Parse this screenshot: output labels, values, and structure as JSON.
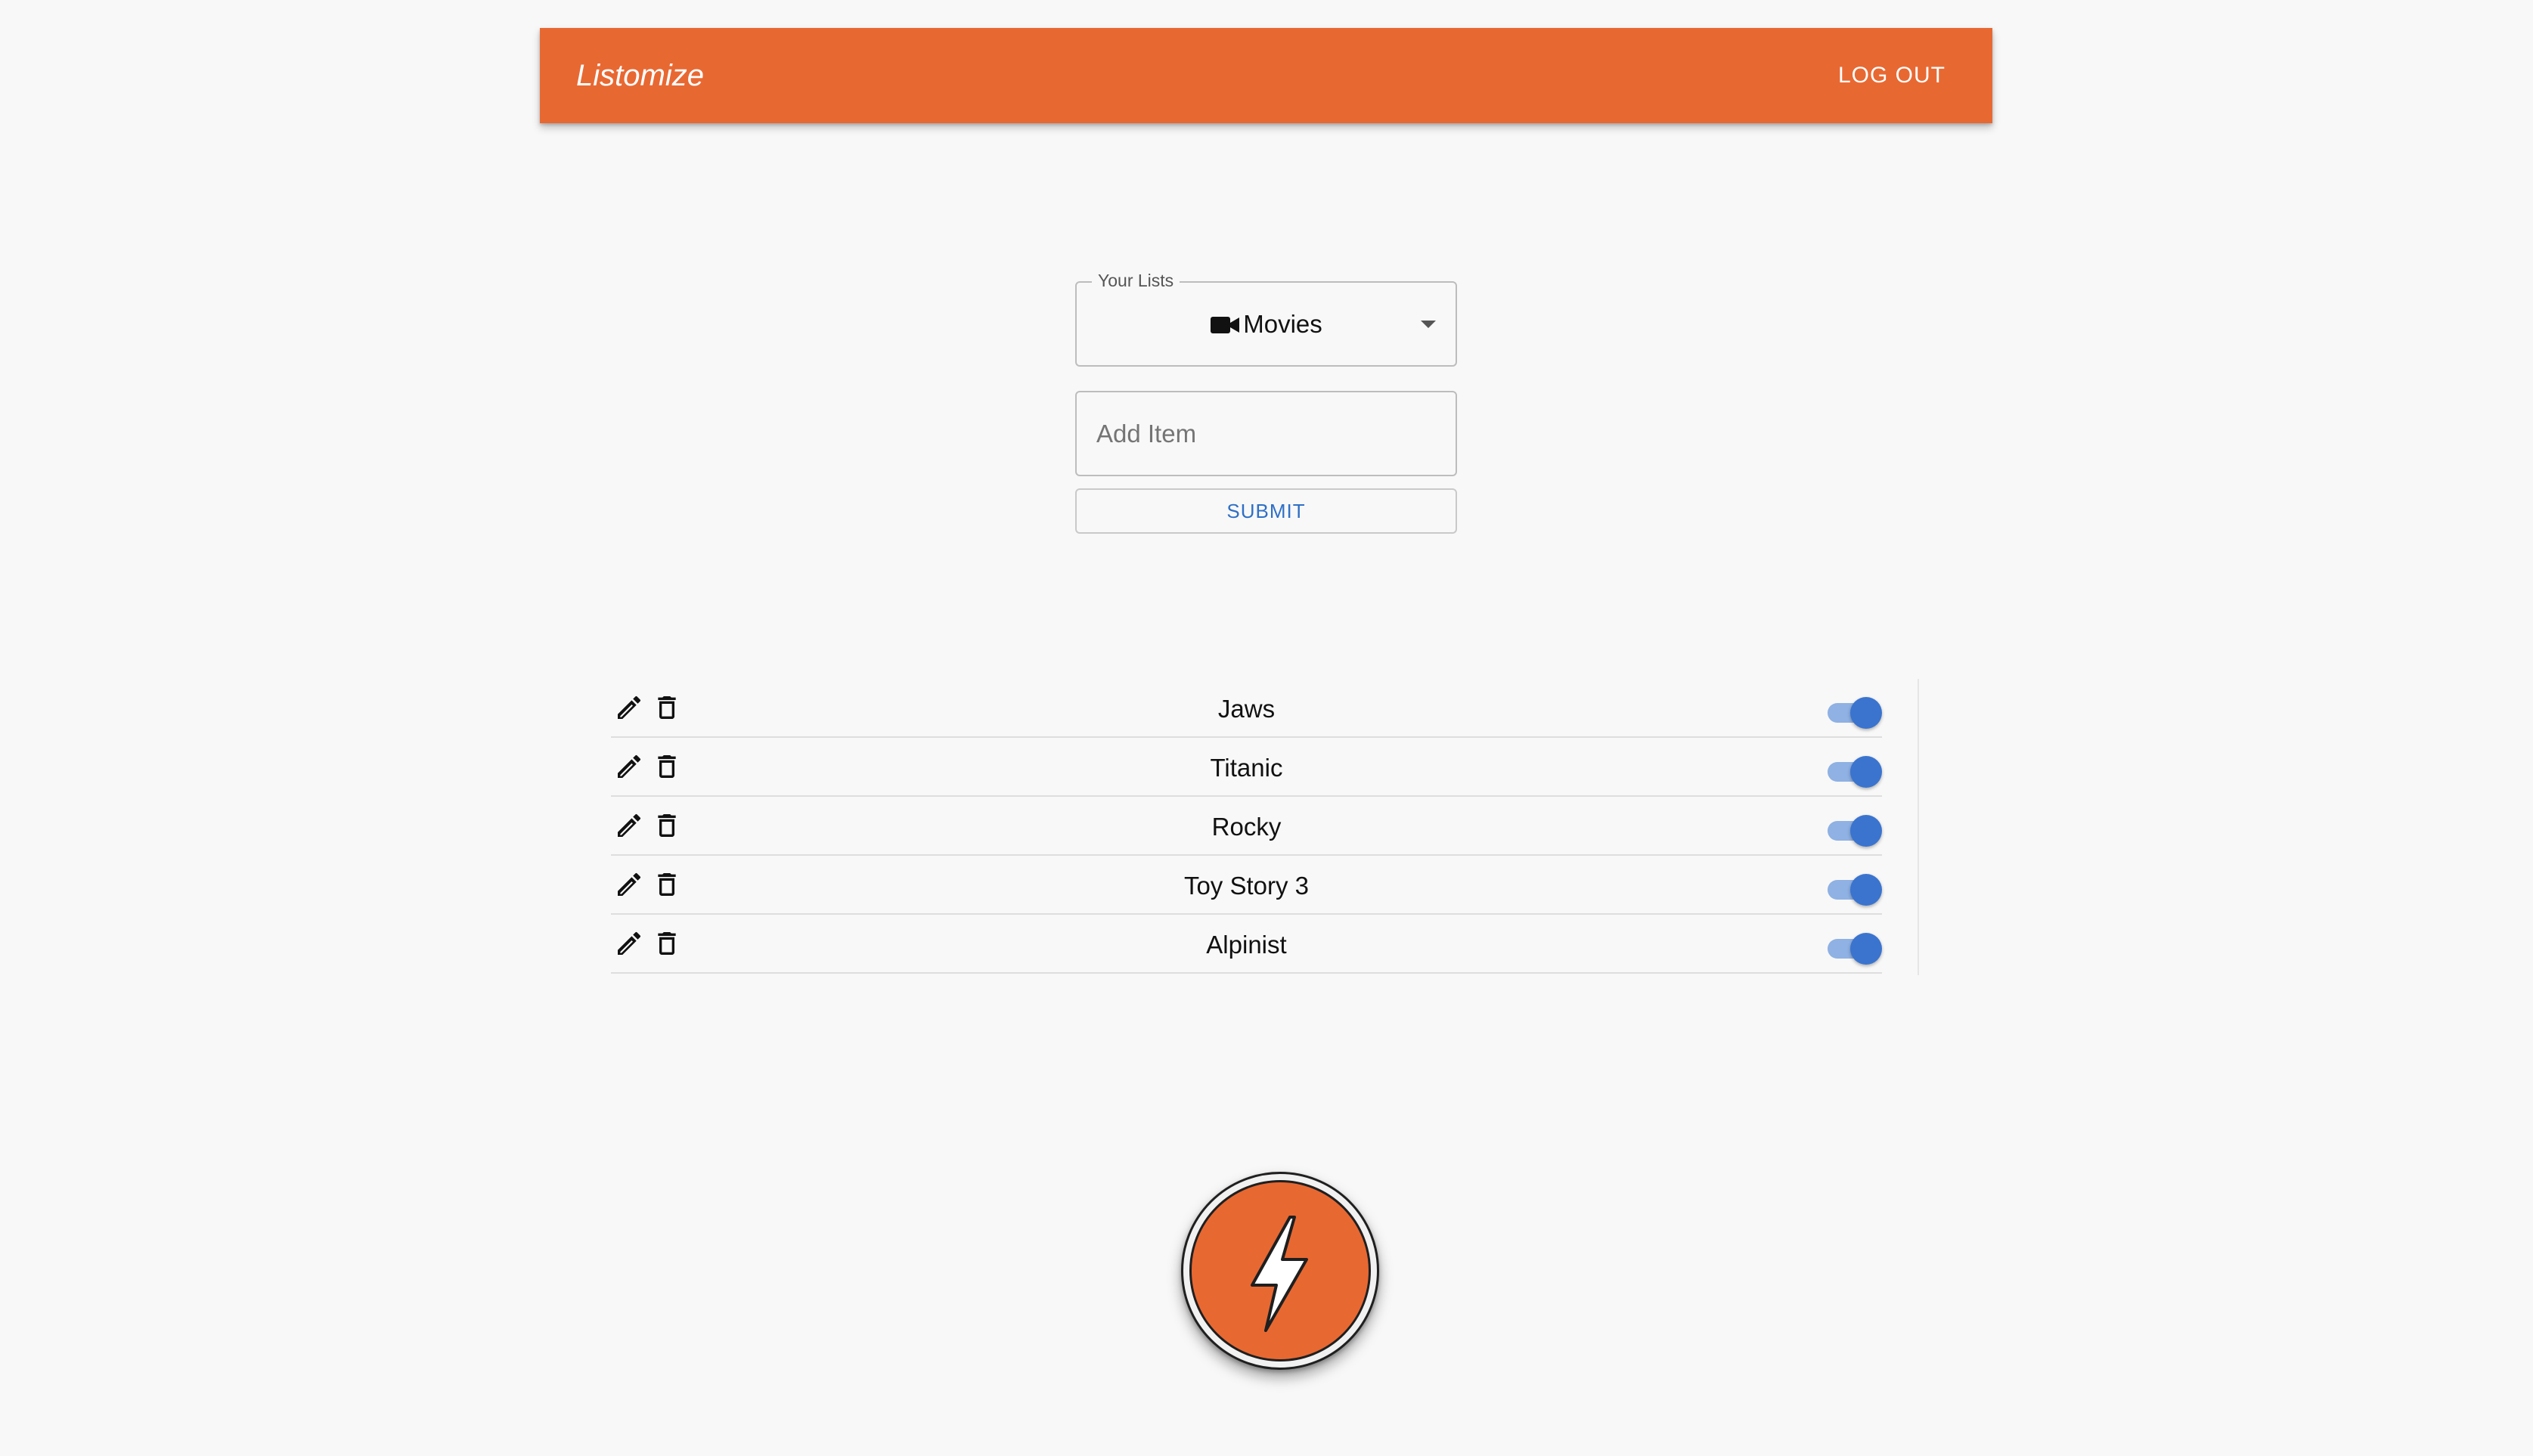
{
  "header": {
    "brand": "Listomize",
    "logout_label": "LOG OUT",
    "color": "#e86832"
  },
  "list_select": {
    "label": "Your Lists",
    "selected_value": "Movies",
    "selected_icon": "video-camera-icon"
  },
  "add_item": {
    "placeholder": "Add Item",
    "value": ""
  },
  "submit": {
    "label": "SUBMIT"
  },
  "items": [
    {
      "label": "Jaws",
      "enabled": true
    },
    {
      "label": "Titanic",
      "enabled": true
    },
    {
      "label": "Rocky",
      "enabled": true
    },
    {
      "label": "Toy Story 3",
      "enabled": true
    },
    {
      "label": "Alpinist",
      "enabled": true
    }
  ],
  "row_icons": [
    "pencil-icon",
    "trash-icon"
  ],
  "fab": {
    "icon": "lightning-bolt-icon"
  },
  "colors": {
    "accent": "#e86832",
    "toggle_on": "#3a74cf",
    "submit_text": "#2f6fc6"
  }
}
